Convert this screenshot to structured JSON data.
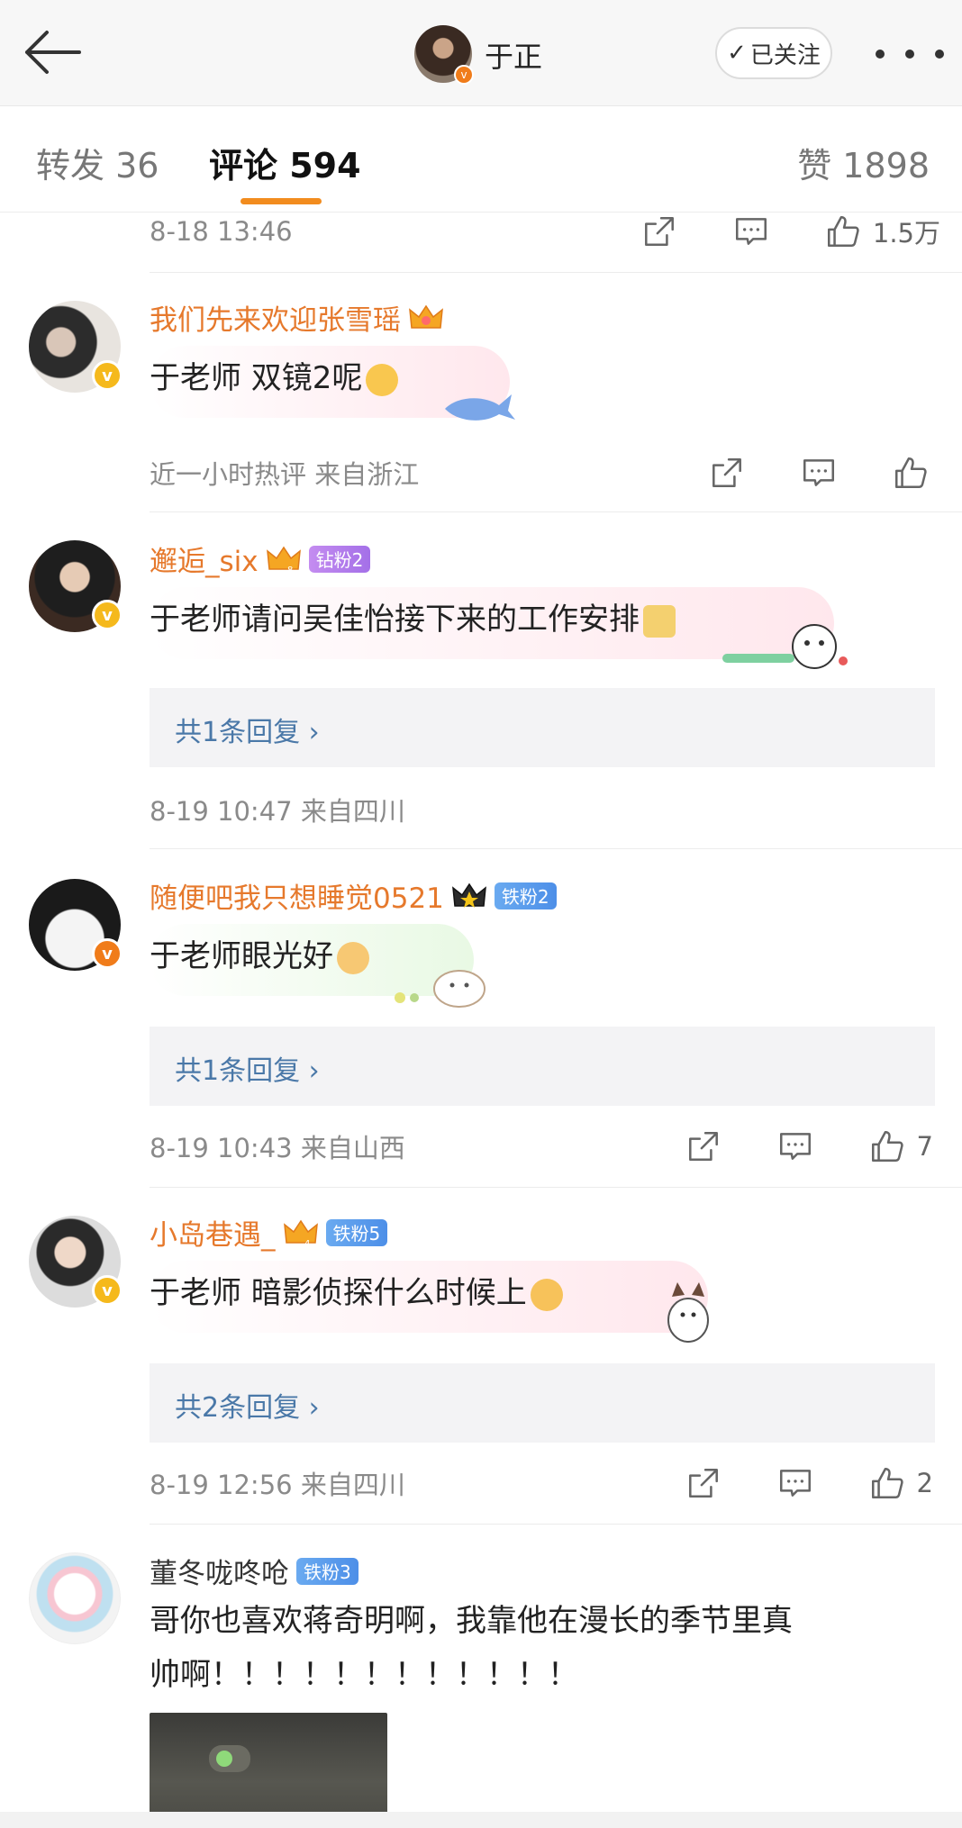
{
  "header": {
    "user_name": "于正",
    "follow_label": "已关注",
    "follow_check": "✓"
  },
  "tabs": {
    "repost": "转发 36",
    "comment": "评论 594",
    "like": "赞 1898"
  },
  "top_item": {
    "time": "8-18 13:46",
    "likes": "1.5万"
  },
  "comments": [
    {
      "user": "我们先来欢迎张雪瑶",
      "text": "于老师 双镜2呢",
      "meta": "近一小时热评  来自浙江",
      "likes": "",
      "verified": "gold"
    },
    {
      "user": "邂逅_six",
      "fan_badge": "钻粉2",
      "crown_level": "8",
      "text": "于老师请问吴佳怡接下来的工作安排",
      "reply": "共1条回复 ›",
      "meta": "8-19 10:47  来自四川",
      "verified": "gold"
    },
    {
      "user": "随便吧我只想睡觉0521",
      "fan_badge": "铁粉2",
      "text": "于老师眼光好",
      "reply": "共1条回复 ›",
      "meta": "8-19 10:43  来自山西",
      "likes": "7",
      "verified": "orange"
    },
    {
      "user": "小岛巷遇_",
      "fan_badge": "铁粉5",
      "crown_level": "4",
      "text": "于老师 暗影侦探什么时候上",
      "reply": "共2条回复 ›",
      "meta": "8-19 12:56  来自四川",
      "likes": "2",
      "verified": "gold"
    },
    {
      "user": "董冬咙咚呛",
      "fan_badge": "铁粉3",
      "text_line1": "哥你也喜欢蒋奇明啊，我靠他在漫长的季节里真",
      "text_line2": "帅啊！！！！！！！！！！！！",
      "verified": "none"
    }
  ],
  "icons": [
    "back-arrow-icon",
    "more-icon",
    "share-icon",
    "comment-icon",
    "like-icon",
    "crown-icon",
    "verified-icon"
  ],
  "colors": {
    "accent_orange": "#f28c1e",
    "username_orange": "#e6792c",
    "reply_link": "#4a78a8",
    "verified_gold": "#f5b91c"
  }
}
